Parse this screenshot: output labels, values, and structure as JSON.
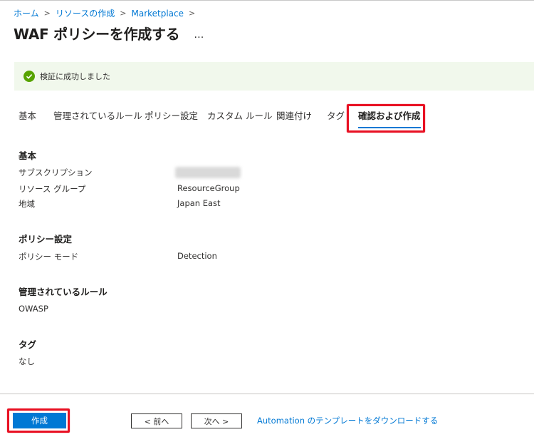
{
  "breadcrumb": {
    "items": [
      "ホーム",
      "リソースの作成",
      "Marketplace"
    ],
    "separator": ">"
  },
  "page": {
    "title": "WAF ポリシーを作成する",
    "more_label": "…"
  },
  "banner": {
    "message": "検証に成功しました",
    "icon": "check-circle-icon",
    "color": "#57a300"
  },
  "tabs": [
    {
      "label": "基本",
      "active": false
    },
    {
      "label": "管理されているルール",
      "active": false
    },
    {
      "label": "ポリシー設定",
      "active": false
    },
    {
      "label": "カスタム ルール",
      "active": false
    },
    {
      "label": "関連付け",
      "active": false
    },
    {
      "label": "タグ",
      "active": false
    },
    {
      "label": "確認および作成",
      "active": true
    }
  ],
  "sections": {
    "basics": {
      "title": "基本",
      "rows": [
        {
          "label": "サブスクリプション",
          "value": ""
        },
        {
          "label": "リソース グループ",
          "value": "ResourceGroup"
        },
        {
          "label": "地域",
          "value": "Japan East"
        }
      ]
    },
    "policy_settings": {
      "title": "ポリシー設定",
      "rows": [
        {
          "label": "ポリシー モード",
          "value": "Detection"
        }
      ]
    },
    "managed_rules": {
      "title": "管理されているルール",
      "value": "OWASP"
    },
    "tags": {
      "title": "タグ",
      "value": "なし"
    }
  },
  "footer": {
    "create_label": "作成",
    "prev_label": "< 前へ",
    "next_label": "次へ >",
    "download_link": "Automation のテンプレートをダウンロードする"
  },
  "colors": {
    "accent": "#0078d4",
    "highlight": "#e81123",
    "banner_bg": "#f1f8ec"
  }
}
